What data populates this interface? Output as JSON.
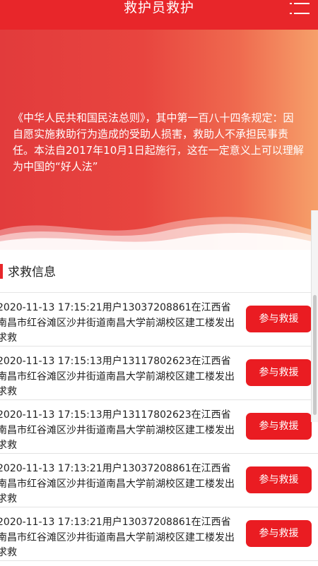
{
  "header": {
    "title": "救护员救护",
    "menu_icon": "list-icon"
  },
  "banner": {
    "text": "《中华人民共和国民法总则》，其中第一百八十四条规定：因自愿实施救助行为造成的受助人损害，救助人不承担民事责任。本法自2017年10月1日起施行，这在一定意义上可以理解为中国的“好人法”"
  },
  "section": {
    "title": "求救信息"
  },
  "requests": [
    {
      "text": "2020-11-13 17:15:21用户13037208861在江西省南昌市红谷滩区沙井街道南昌大学前湖校区建工楼发出求救",
      "button": "参与救援"
    },
    {
      "text": "2020-11-13 17:15:13用户13117802623在江西省南昌市红谷滩区沙井街道南昌大学前湖校区建工楼发出求救",
      "button": "参与救援"
    },
    {
      "text": "2020-11-13 17:15:13用户13117802623在江西省南昌市红谷滩区沙井街道南昌大学前湖校区建工楼发出求救",
      "button": "参与救援"
    },
    {
      "text": "2020-11-13 17:13:21用户13037208861在江西省南昌市红谷滩区沙井街道南昌大学前湖校区建工楼发出求救",
      "button": "参与救援"
    },
    {
      "text": "2020-11-13 17:13:21用户13037208861在江西省南昌市红谷滩区沙井街道南昌大学前湖校区建工楼发出求救",
      "button": "参与救援"
    }
  ],
  "colors": {
    "primary": "#e8262a",
    "button": "#ea1c22",
    "banner_end": "#f6a06a"
  }
}
